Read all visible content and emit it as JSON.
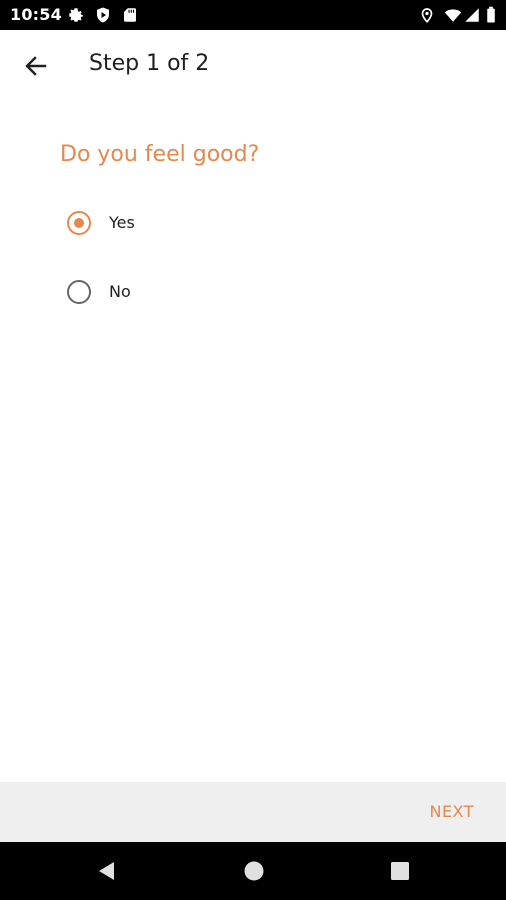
{
  "status_bar": {
    "time": "10:54",
    "icons_left": [
      "gear-icon",
      "shield-play-icon",
      "sd-card-icon"
    ],
    "icons_right": [
      "location-icon",
      "wifi-icon",
      "signal-icon",
      "battery-icon"
    ]
  },
  "app_bar": {
    "title": "Step 1 of 2",
    "back_icon": "arrow-left-icon"
  },
  "form": {
    "question": "Do you feel good?",
    "options": [
      {
        "label": "Yes",
        "selected": true
      },
      {
        "label": "No",
        "selected": false
      }
    ]
  },
  "bottom_bar": {
    "next_label": "NEXT"
  },
  "nav_bar": {
    "icons": [
      "back-triangle-icon",
      "home-circle-icon",
      "recents-square-icon"
    ]
  },
  "colors": {
    "accent": "#e4884e",
    "status_bar": "#000000",
    "bottom_bar": "#efefef"
  }
}
